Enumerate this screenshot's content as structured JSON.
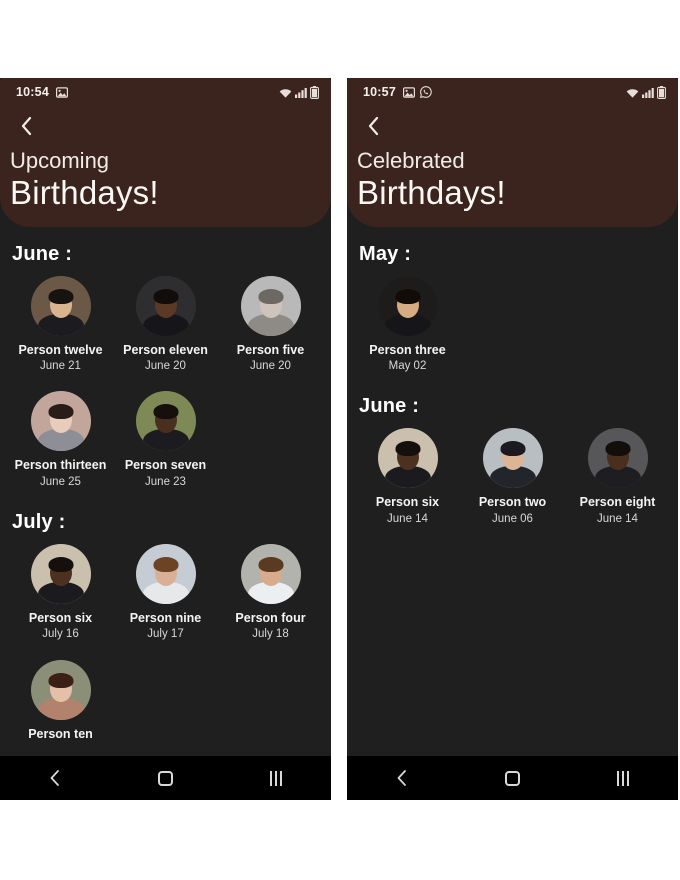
{
  "page": {
    "background": "#ffffff",
    "header_color": "#3b241e",
    "body_color": "#1f1f1f",
    "navbar_color": "#000000"
  },
  "screens": [
    {
      "id": "upcoming",
      "status_bar": {
        "time": "10:54",
        "left_icons": [
          "image-icon"
        ],
        "right_icons": [
          "wifi-icon",
          "signal-icon",
          "battery-icon"
        ]
      },
      "header": {
        "back_label": "‹",
        "title_small": "Upcoming",
        "title_large": "Birthdays!"
      },
      "sections": [
        {
          "month_label": "June :",
          "people": [
            {
              "name": "Person twelve",
              "date": "June 21",
              "avatar": {
                "bg": "#6b5846",
                "skin": "#d8b48f",
                "hair": "#171310",
                "cloth": "#1c1c20"
              }
            },
            {
              "name": "Person eleven",
              "date": "June 20",
              "avatar": {
                "bg": "#2e2e30",
                "skin": "#5a3a26",
                "hair": "#120d0a",
                "cloth": "#15151a"
              }
            },
            {
              "name": "Person five",
              "date": "June 20",
              "avatar": {
                "bg": "#b9b9b9",
                "skin": "#cfc4bb",
                "hair": "#6e6862",
                "cloth": "#8e8a86"
              }
            },
            {
              "name": "Person thirteen",
              "date": "June 25",
              "avatar": {
                "bg": "#c3a69b",
                "skin": "#e8cdbc",
                "hair": "#2a1d18",
                "cloth": "#8e8e96"
              }
            },
            {
              "name": "Person seven",
              "date": "June 23",
              "avatar": {
                "bg": "#7d8a55",
                "skin": "#4a2f1f",
                "hair": "#16100c",
                "cloth": "#1b1b20"
              }
            }
          ]
        },
        {
          "month_label": "July :",
          "people": [
            {
              "name": "Person six",
              "date": "July 16",
              "avatar": {
                "bg": "#cbc0ae",
                "skin": "#4d3120",
                "hair": "#15100d",
                "cloth": "#1b1b1f"
              }
            },
            {
              "name": "Person nine",
              "date": "July 17",
              "avatar": {
                "bg": "#c6ccd3",
                "skin": "#d9b095",
                "hair": "#6d4326",
                "cloth": "#e6e8ea"
              }
            },
            {
              "name": "Person four",
              "date": "July 18",
              "avatar": {
                "bg": "#b3b3ad",
                "skin": "#d7ab8c",
                "hair": "#5b3a22",
                "cloth": "#eceff1"
              }
            },
            {
              "name": "Person ten",
              "date": "",
              "avatar": {
                "bg": "#8c8f78",
                "skin": "#e4c0a8",
                "hair": "#3a2016",
                "cloth": "#b3826c"
              }
            }
          ]
        }
      ],
      "nav": {
        "back": "back-icon",
        "home": "home-icon",
        "recents": "recents-icon"
      }
    },
    {
      "id": "celebrated",
      "status_bar": {
        "time": "10:57",
        "left_icons": [
          "image-icon",
          "whatsapp-icon"
        ],
        "right_icons": [
          "wifi-icon",
          "signal-icon",
          "battery-icon"
        ]
      },
      "header": {
        "back_label": "‹",
        "title_small": "Celebrated",
        "title_large": "Birthdays!"
      },
      "sections": [
        {
          "month_label": "May :",
          "people": [
            {
              "name": "Person three",
              "date": "May 02",
              "avatar": {
                "bg": "#1d1c1a",
                "skin": "#d7ac83",
                "hair": "#120c08",
                "cloth": "#16161a"
              }
            }
          ]
        },
        {
          "month_label": "June :",
          "people": [
            {
              "name": "Person six",
              "date": "June 14",
              "avatar": {
                "bg": "#cbc0ae",
                "skin": "#4d3120",
                "hair": "#15100d",
                "cloth": "#1b1b1f"
              }
            },
            {
              "name": "Person two",
              "date": "June 06",
              "avatar": {
                "bg": "#b9bec2",
                "skin": "#dcb596",
                "hair": "#1a1a20",
                "cloth": "#22252c"
              }
            },
            {
              "name": "Person eight",
              "date": "June 14",
              "avatar": {
                "bg": "#575759",
                "skin": "#4b2f1e",
                "hair": "#130e0a",
                "cloth": "#1d1d22"
              }
            }
          ]
        }
      ],
      "nav": {
        "back": "back-icon",
        "home": "home-icon",
        "recents": "recents-icon"
      }
    }
  ]
}
